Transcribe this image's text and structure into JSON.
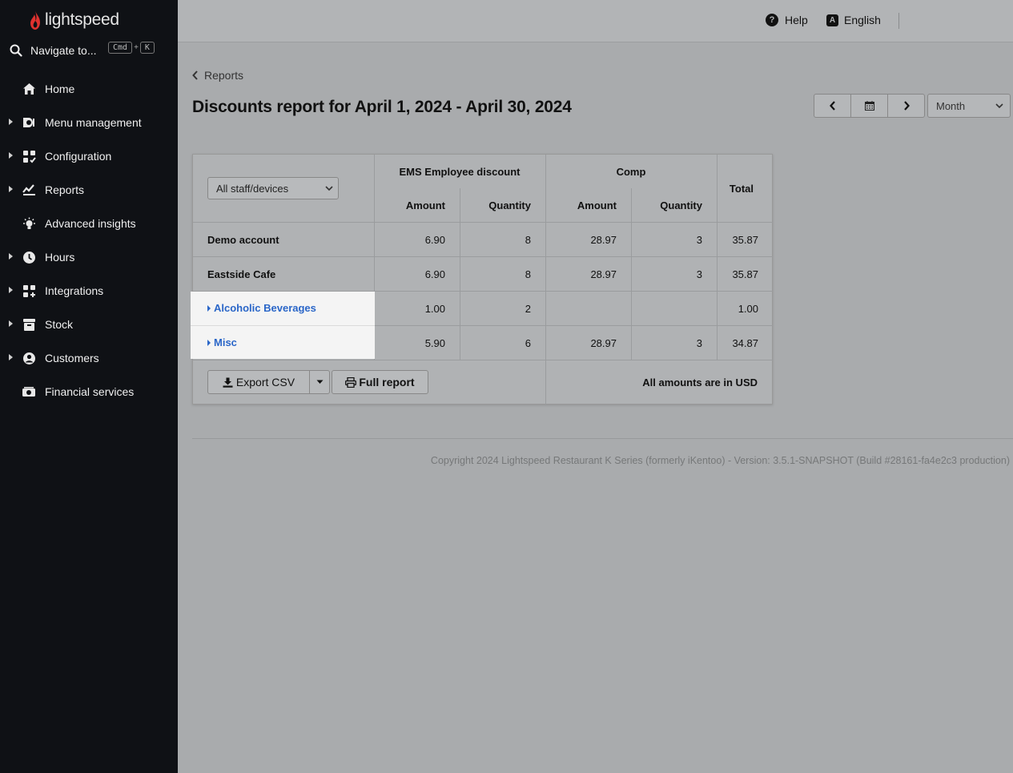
{
  "sidebar": {
    "logo_text": "lightspeed",
    "search": {
      "label": "Navigate to...",
      "shortcut_mod": "Cmd",
      "shortcut_plus": "+",
      "shortcut_key": "K"
    },
    "items": [
      {
        "label": "Home",
        "icon": "home-icon",
        "expandable": false
      },
      {
        "label": "Menu management",
        "icon": "menu-management-icon",
        "expandable": true
      },
      {
        "label": "Configuration",
        "icon": "configuration-icon",
        "expandable": true
      },
      {
        "label": "Reports",
        "icon": "reports-icon",
        "expandable": true
      },
      {
        "label": "Advanced insights",
        "icon": "lightbulb-icon",
        "expandable": false
      },
      {
        "label": "Hours",
        "icon": "clock-icon",
        "expandable": true
      },
      {
        "label": "Integrations",
        "icon": "integrations-icon",
        "expandable": true
      },
      {
        "label": "Stock",
        "icon": "stock-icon",
        "expandable": true
      },
      {
        "label": "Customers",
        "icon": "customer-icon",
        "expandable": true
      },
      {
        "label": "Financial services",
        "icon": "cash-icon",
        "expandable": false
      }
    ]
  },
  "topbar": {
    "help_label": "Help",
    "help_glyph": "?",
    "language_label": "English",
    "language_glyph": "A"
  },
  "breadcrumb": {
    "label": "Reports"
  },
  "page": {
    "title": "Discounts report for April 1, 2024 - April 30, 2024"
  },
  "period_select": {
    "value": "Month"
  },
  "report": {
    "filter_value": "All staff/devices",
    "groups": [
      {
        "label": "EMS Employee discount",
        "columns": [
          "Amount",
          "Quantity"
        ]
      },
      {
        "label": "Comp",
        "columns": [
          "Amount",
          "Quantity"
        ]
      }
    ],
    "total_label": "Total",
    "rows": [
      {
        "name": "Demo account",
        "link": false,
        "ems_amount": "6.90",
        "ems_quantity": "8",
        "comp_amount": "28.97",
        "comp_quantity": "3",
        "total": "35.87"
      },
      {
        "name": "Eastside Cafe",
        "link": false,
        "ems_amount": "6.90",
        "ems_quantity": "8",
        "comp_amount": "28.97",
        "comp_quantity": "3",
        "total": "35.87"
      },
      {
        "name": "Alcoholic Beverages",
        "link": true,
        "ems_amount": "1.00",
        "ems_quantity": "2",
        "comp_amount": "",
        "comp_quantity": "",
        "total": "1.00"
      },
      {
        "name": "Misc",
        "link": true,
        "ems_amount": "5.90",
        "ems_quantity": "6",
        "comp_amount": "28.97",
        "comp_quantity": "3",
        "total": "34.87"
      }
    ],
    "export_label": "Export CSV",
    "full_report_label": "Full report",
    "currency_note": "All amounts are in USD"
  },
  "footer": {
    "copyright": "Copyright 2024 Lightspeed Restaurant K Series (formerly iKentoo) - Version: 3.5.1-SNAPSHOT (Build #28161-fa4e2c3 production)"
  },
  "colors": {
    "sidebar_bg": "#0f1115",
    "link": "#2a66c8",
    "logo_red": "#e0322f"
  }
}
